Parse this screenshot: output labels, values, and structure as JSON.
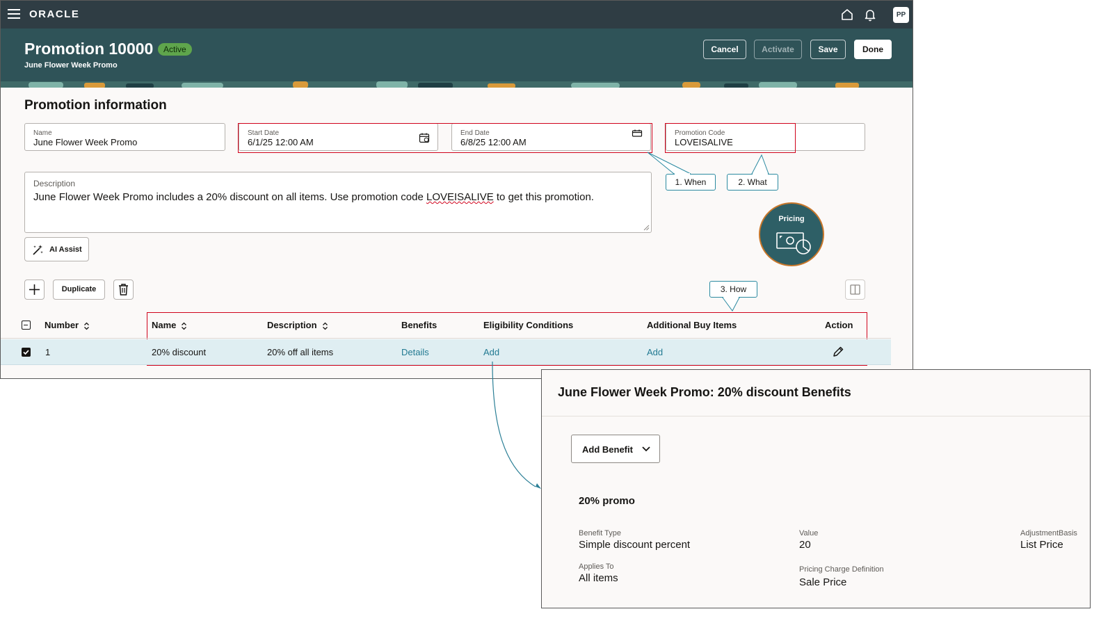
{
  "app": {
    "logo": "ORACLE",
    "avatar": "PP"
  },
  "header": {
    "title": "Promotion 10000",
    "status": "Active",
    "subtitle": "June Flower Week Promo",
    "buttons": {
      "cancel": "Cancel",
      "activate": "Activate",
      "save": "Save",
      "done": "Done"
    }
  },
  "promotion_info": {
    "section_title": "Promotion information",
    "name": {
      "label": "Name",
      "value": "June Flower Week Promo"
    },
    "start_date": {
      "label": "Start Date",
      "value": "6/1/25 12:00 AM"
    },
    "end_date": {
      "label": "End Date",
      "value": "6/8/25 12:00 AM"
    },
    "promotion_code": {
      "label": "Promotion Code",
      "value": "LOVEISALIVE"
    },
    "description": {
      "label": "Description",
      "before": "June Flower Week Promo includes a 20% discount on all items. Use promotion code ",
      "code": "LOVEISALIVE",
      "after": " to get this promotion."
    },
    "ai_assist": "AI Assist"
  },
  "callouts": {
    "when": "1. When",
    "what": "2. What",
    "how": "3. How"
  },
  "pricing_badge": "Pricing",
  "toolbar": {
    "duplicate": "Duplicate"
  },
  "grid": {
    "columns": {
      "number": "Number",
      "name": "Name",
      "description": "Description",
      "benefits": "Benefits",
      "eligibility": "Eligibility Conditions",
      "additional_buy": "Additional Buy Items",
      "action": "Action"
    },
    "rows": [
      {
        "number": "1",
        "name": "20% discount",
        "description": "20% off all items",
        "benefits": "Details",
        "eligibility": "Add",
        "additional_buy": "Add",
        "selected": true
      }
    ]
  },
  "benefits_panel": {
    "title": "June Flower Week Promo: 20% discount Benefits",
    "add_benefit": "Add Benefit",
    "benefit": {
      "name": "20% promo",
      "benefit_type_label": "Benefit Type",
      "benefit_type": "Simple discount percent",
      "value_label": "Value",
      "value": "20",
      "adjustment_basis_label": "AdjustmentBasis",
      "adjustment_basis": "List Price",
      "applies_to_label": "Applies To",
      "applies_to": "All items",
      "pricing_charge_label": "Pricing Charge Definition",
      "pricing_charge": "Sale Price"
    }
  },
  "colors": {
    "topbar": "#2f3d44",
    "header": "#2f5358",
    "active_badge": "#5fa54c",
    "highlight_box": "#d0021b",
    "callout_border": "#2b8aa1",
    "link": "#227a92",
    "selected_row": "#dfeef2"
  },
  "icons": [
    "hamburger-icon",
    "home-icon",
    "bell-icon",
    "calendar-icon",
    "ai-wand-icon",
    "pricing-money-icon",
    "plus-icon",
    "trash-icon",
    "panel-icon",
    "sort-icon",
    "pencil-icon",
    "chevron-down-icon",
    "checkbox-icon"
  ]
}
